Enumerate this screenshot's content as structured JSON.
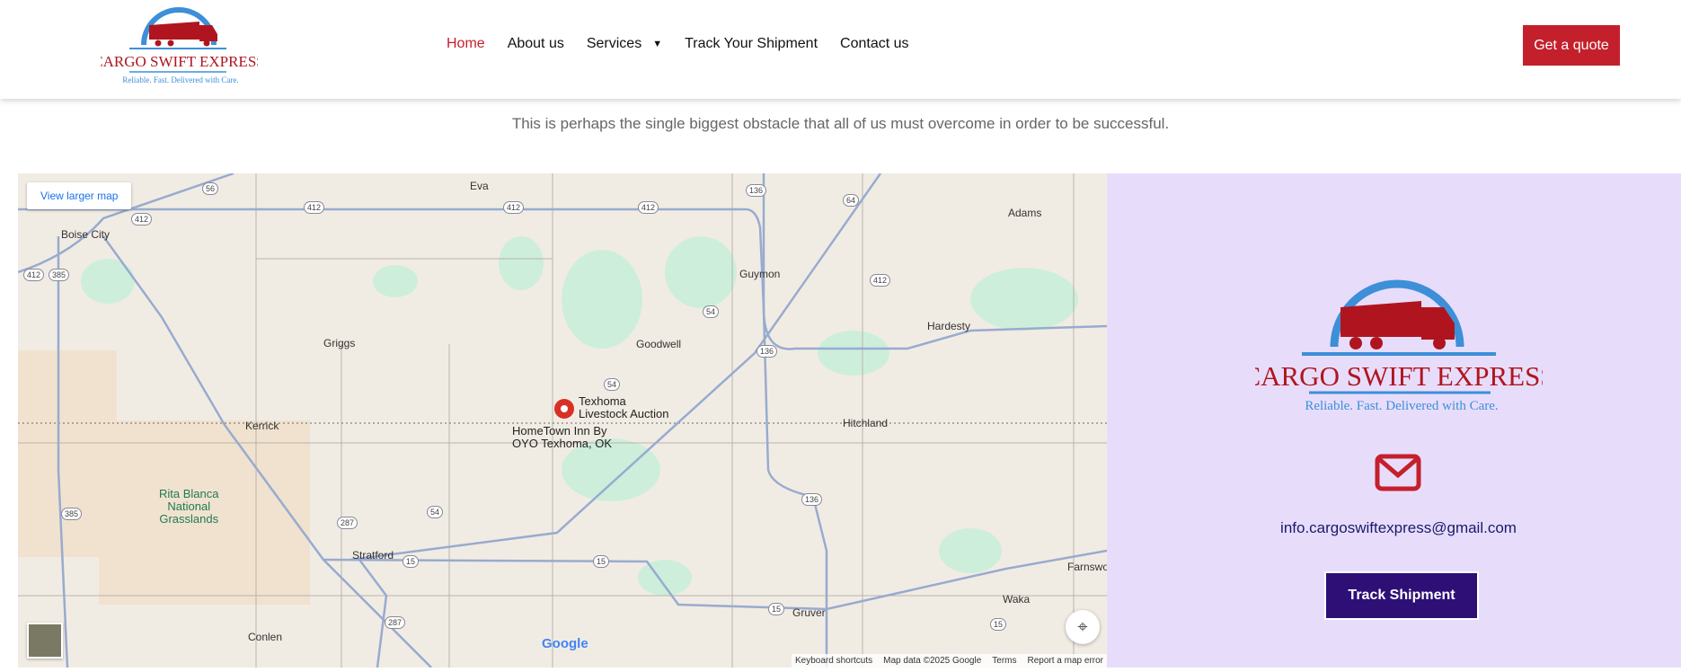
{
  "brand": {
    "name": "CARGO SWIFT EXPRESS",
    "slogan": "Reliable. Fast. Delivered with Care.",
    "colors": {
      "red": "#c4202c",
      "blue": "#3d8fd8",
      "purple": "#2e0f76"
    }
  },
  "nav": {
    "items": [
      {
        "label": "Home",
        "active": true
      },
      {
        "label": "About us"
      },
      {
        "label": "Services",
        "caret": true
      },
      {
        "label": "Track Your Shipment"
      },
      {
        "label": "Contact us"
      }
    ],
    "cta": "Get a quote"
  },
  "tagline": "This is perhaps the single biggest obstacle that all of us must overcome in order to be successful.",
  "map": {
    "view_larger": "View larger map",
    "places": [
      "Eva",
      "Boise City",
      "Adams",
      "Guymon",
      "Hardesty",
      "Griggs",
      "Goodwell",
      "Kerrick",
      "Hitchland",
      "Stratford",
      "Gruver",
      "Waka",
      "Conlen",
      "Farnswo"
    ],
    "marker": {
      "line1": "Texhoma",
      "line2": "Livestock Auction"
    },
    "hotel": {
      "line1": "HomeTown Inn By",
      "line2": "OYO Texhoma, OK"
    },
    "park": {
      "line1": "Rita Blanca",
      "line2": "National",
      "line3": "Grasslands"
    },
    "routes": [
      "56",
      "412",
      "412",
      "412",
      "136",
      "64",
      "412",
      "385",
      "412",
      "412",
      "54",
      "136",
      "54",
      "136",
      "287",
      "54",
      "15",
      "15",
      "15",
      "15",
      "287",
      "385"
    ],
    "attribution": [
      "Keyboard shortcuts",
      "Map data ©2025 Google",
      "Terms",
      "Report a map error"
    ],
    "google": "Google"
  },
  "contact": {
    "email": "info.cargoswiftexpress@gmail.com",
    "track_button": "Track Shipment"
  }
}
